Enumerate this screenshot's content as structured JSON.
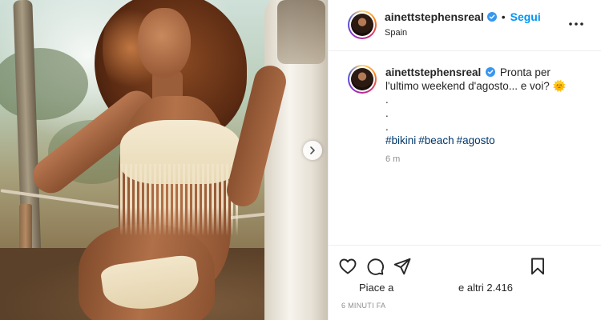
{
  "post": {
    "author": "ainettstephensreal",
    "location": "Spain",
    "follow_label": "Segui",
    "separator": "•",
    "caption_line1": "Pronta per",
    "caption_line2": "l'ultimo weekend d'agosto... e voi?",
    "sun_emoji": "🌞",
    "caption_dots": [
      ".",
      ".",
      "."
    ],
    "hashtags": [
      "#bikini",
      "#beach",
      "#agosto"
    ],
    "comment_time": "6 m",
    "likes_part1": "Piace a",
    "likes_part2": "e altri 2.416",
    "post_time": "6 MINUTI FA"
  },
  "icons": {
    "verified": "verified-badge-icon",
    "more": "more-options-icon",
    "like": "heart-icon",
    "comment": "comment-icon",
    "share": "share-icon",
    "save": "bookmark-icon",
    "next": "chevron-right-icon"
  },
  "colors": {
    "link_blue": "#0095f6",
    "hashtag": "#00376b",
    "muted": "#8e8e8e",
    "text": "#262626"
  }
}
